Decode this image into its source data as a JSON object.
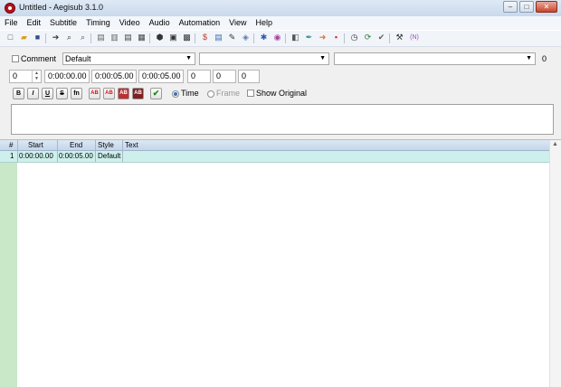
{
  "window": {
    "title": "Untitled - Aegisub 3.1.0"
  },
  "menubar": [
    "File",
    "Edit",
    "Subtitle",
    "Timing",
    "Video",
    "Audio",
    "Automation",
    "View",
    "Help"
  ],
  "toolbar": {
    "icons": [
      {
        "name": "new-file-icon",
        "glyph": "□",
        "color": "#555555"
      },
      {
        "name": "open-file-icon",
        "glyph": "▰",
        "color": "#d9a21b"
      },
      {
        "name": "save-icon",
        "glyph": "■",
        "color": "#2f4f8f"
      },
      {
        "name": "jump-to-icon",
        "glyph": "➔",
        "color": "#333333"
      },
      {
        "name": "find-icon",
        "glyph": "⌕",
        "color": "#333333"
      },
      {
        "name": "find-replace-icon",
        "glyph": "⌕",
        "color": "#555555"
      },
      {
        "name": "copy-icon",
        "glyph": "▤",
        "color": "#666666"
      },
      {
        "name": "paste-icon",
        "glyph": "▥",
        "color": "#666666"
      },
      {
        "name": "properties-icon",
        "glyph": "▤",
        "color": "#444444"
      },
      {
        "name": "attachments-icon",
        "glyph": "▦",
        "color": "#444444"
      },
      {
        "name": "fonts-collector-icon",
        "glyph": "⬢",
        "color": "#333333"
      },
      {
        "name": "video-open-icon",
        "glyph": "▣",
        "color": "#333333"
      },
      {
        "name": "video-details-icon",
        "glyph": "▩",
        "color": "#333333"
      },
      {
        "name": "styles-manager-icon",
        "glyph": "$",
        "color": "#c0392b"
      },
      {
        "name": "resample-icon",
        "glyph": "▤",
        "color": "#3a6fb4"
      },
      {
        "name": "spellcheck-icon",
        "glyph": "✎",
        "color": "#333333"
      },
      {
        "name": "translation-assistant-icon",
        "glyph": "◈",
        "color": "#5a7ab0"
      },
      {
        "name": "styling-assistant-icon",
        "glyph": "✱",
        "color": "#2b5cb0"
      },
      {
        "name": "kanji-timer-icon",
        "glyph": "◉",
        "color": "#a040a0"
      },
      {
        "name": "shift-times-icon",
        "glyph": "◧",
        "color": "#555555"
      },
      {
        "name": "timing-post-processor-icon",
        "glyph": "✒",
        "color": "#2a8a8a"
      },
      {
        "name": "timing-jump-icon",
        "glyph": "➜",
        "color": "#e07020"
      },
      {
        "name": "timing-stop-icon",
        "glyph": "▪",
        "color": "#cc3030"
      },
      {
        "name": "clock-icon",
        "glyph": "◷",
        "color": "#333333"
      },
      {
        "name": "automation-icon",
        "glyph": "⟳",
        "color": "#2f7a3a"
      },
      {
        "name": "check-edit-icon",
        "glyph": "✔",
        "color": "#5a5a5a"
      },
      {
        "name": "options-icon",
        "glyph": "⚒",
        "color": "#333333"
      },
      {
        "name": "lua-icon",
        "glyph": "(N)",
        "color": "#a050c0"
      }
    ]
  },
  "edit": {
    "comment_label": "Comment",
    "style_value": "Default",
    "actor_value": "",
    "effect_value": "",
    "margin_value": "0",
    "layer_value": "0",
    "start_time": "0:00:00.00",
    "end_time": "0:00:05.00",
    "duration": "0:00:05.00",
    "margin_left": "0",
    "margin_right": "0",
    "margin_vertical": "0",
    "format_buttons": [
      "B",
      "I",
      "U",
      "S",
      "fn",
      "AB",
      "AB",
      "AB",
      "AB"
    ],
    "commit_glyph": "✔",
    "time_label": "Time",
    "frame_label": "Frame",
    "show_original_label": "Show Original"
  },
  "grid": {
    "headers": [
      "#",
      "Start",
      "End",
      "Style",
      "Text"
    ],
    "rows": [
      {
        "num": "1",
        "start": "0:00:00.00",
        "end": "0:00:05.00",
        "style": "Default",
        "text": ""
      }
    ]
  },
  "colors": {
    "grid_left": "#c8e8c8",
    "row_highlight": "#cdf0ec",
    "header": "#c4d6ea"
  }
}
